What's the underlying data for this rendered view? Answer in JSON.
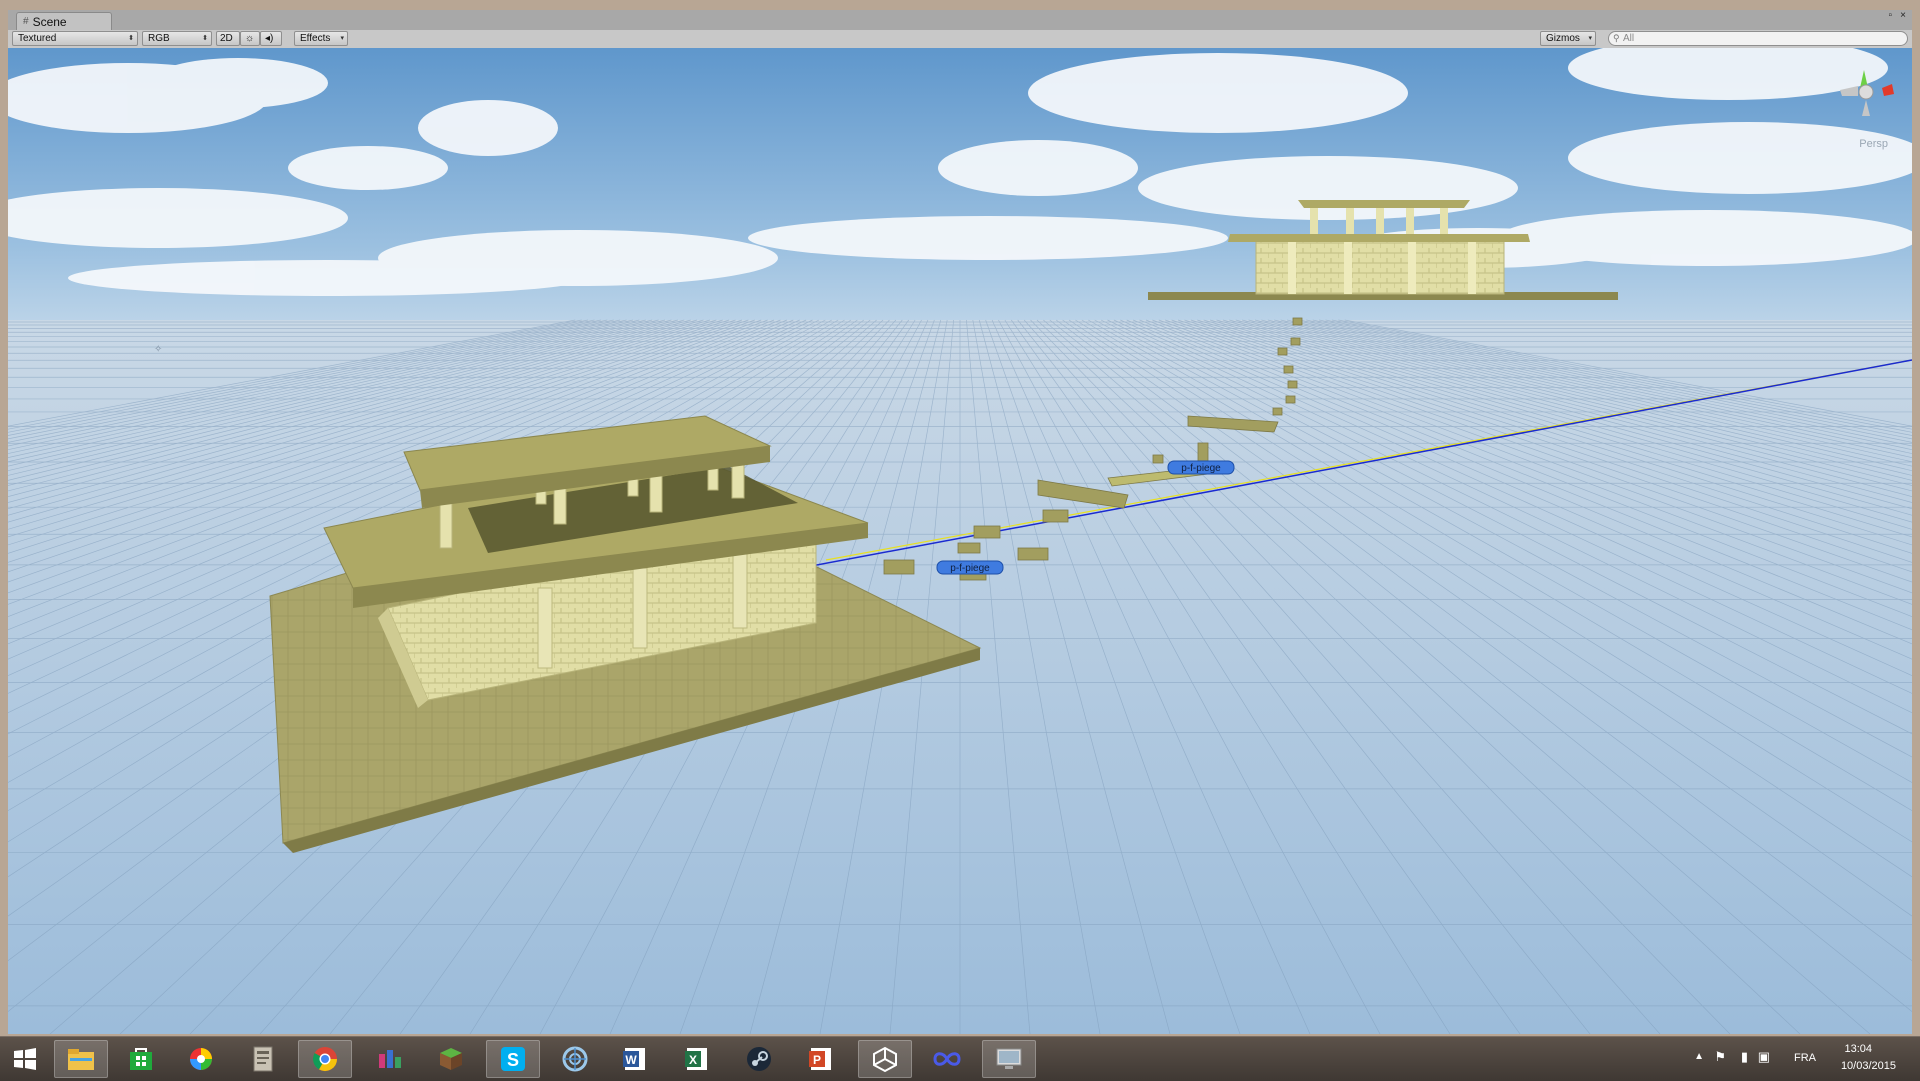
{
  "window": {
    "tab_title": "Scene",
    "controls": [
      "▫",
      "×"
    ]
  },
  "toolbar": {
    "draw_mode": "Textured",
    "render_mode": "RGB",
    "toggle_2d": "2D",
    "lighting_icon": "sun-icon",
    "audio_icon": "speaker-icon",
    "effects_label": "Effects",
    "gizmos_label": "Gizmos",
    "search_placeholder": "All"
  },
  "scene": {
    "gizmo_projection_label": "Persp",
    "object_labels": [
      "p-f-piege",
      "p-f-piege"
    ],
    "colors": {
      "sky_top": "#6fa3d3",
      "sky_horizon": "#dce8f2",
      "ground": "#a9c3db",
      "building_main": "#b5b06b",
      "building_wall": "#e2dfa8",
      "blue_line": "#1020c8",
      "yellow_line": "#e8e020"
    }
  },
  "taskbar": {
    "apps": [
      {
        "name": "start-button",
        "icon": "windows-logo-icon"
      },
      {
        "name": "file-explorer",
        "icon": "folder-icon"
      },
      {
        "name": "store",
        "icon": "store-icon"
      },
      {
        "name": "picasa",
        "icon": "picasa-icon"
      },
      {
        "name": "app-generic",
        "icon": "document-app-icon"
      },
      {
        "name": "chrome",
        "icon": "chrome-icon"
      },
      {
        "name": "rss-app",
        "icon": "rss-icon"
      },
      {
        "name": "minecraft",
        "icon": "minecraft-icon"
      },
      {
        "name": "skype",
        "icon": "skype-icon"
      },
      {
        "name": "app-target",
        "icon": "target-icon"
      },
      {
        "name": "word",
        "icon": "word-icon"
      },
      {
        "name": "excel",
        "icon": "excel-icon"
      },
      {
        "name": "steam",
        "icon": "steam-icon"
      },
      {
        "name": "powerpoint",
        "icon": "powerpoint-icon"
      },
      {
        "name": "unity",
        "icon": "unity-icon"
      },
      {
        "name": "app-infinity",
        "icon": "infinity-icon"
      },
      {
        "name": "app-screen",
        "icon": "monitor-icon"
      }
    ],
    "tray": {
      "language": "FRA",
      "time": "13:04",
      "date": "10/03/2015"
    }
  }
}
